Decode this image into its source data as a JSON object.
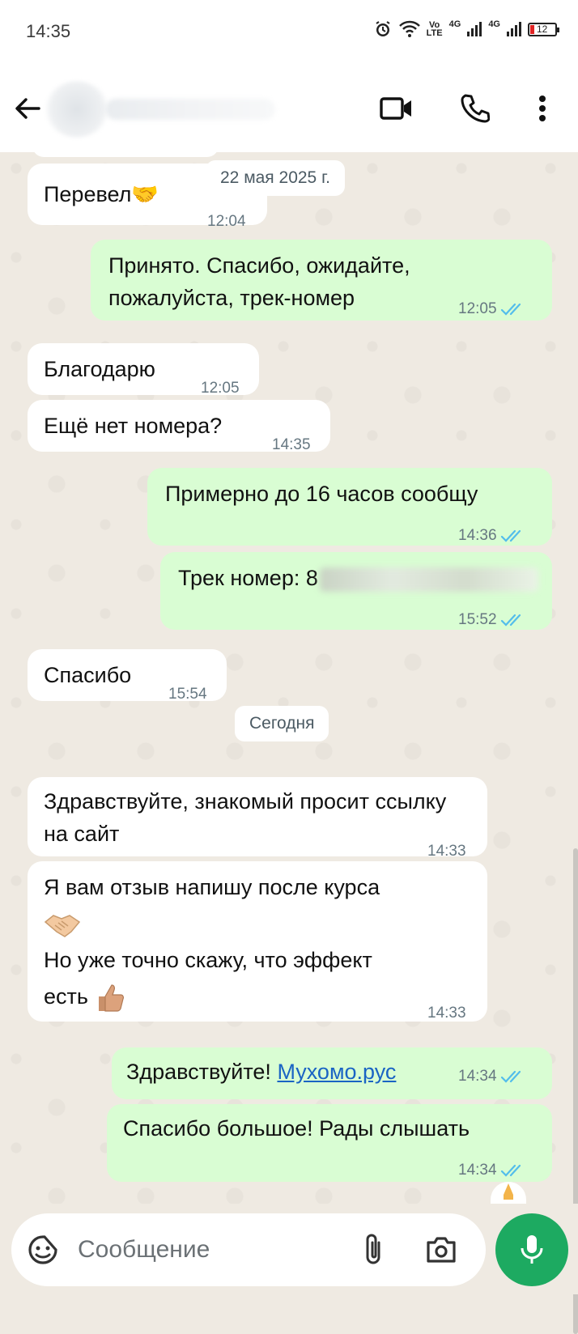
{
  "status_bar": {
    "time": "14:35",
    "volte_top": "Vo",
    "volte_bottom": "LTE",
    "net1": "4G",
    "net2": "4G",
    "battery": "12"
  },
  "header": {
    "back_icon": "arrow-left-icon",
    "video_icon": "video-camera-icon",
    "call_icon": "phone-icon",
    "menu_icon": "more-vertical-icon"
  },
  "chat": {
    "date_old": "22 мая 2025 г.",
    "date_today": "Сегодня",
    "messages": [
      {
        "text": "Перевел🤝",
        "time": "12:04",
        "dir": "in"
      },
      {
        "text": "Принято. Спасибо, ожидайте, пожалуйста, трек-номер",
        "time": "12:05",
        "dir": "out"
      },
      {
        "text": "Благодарю",
        "time": "12:05",
        "dir": "in"
      },
      {
        "text": "Ещё нет номера?",
        "time": "14:35",
        "dir": "in"
      },
      {
        "text": "Примерно до 16 часов сообщу",
        "time": "14:36",
        "dir": "out"
      },
      {
        "text": "Трек номер: 8",
        "time": "15:52",
        "dir": "out"
      },
      {
        "text": "Спасибо",
        "time": "15:54",
        "dir": "in"
      },
      {
        "text": "Здравствуйте, знакомый просит ссылку на сайт",
        "time": "14:33",
        "dir": "in"
      },
      {
        "text_line1": "Я вам отзыв напишу после курса",
        "text_line3": "Но уже точно скажу, что эффект",
        "text_line4": "есть",
        "time": "14:33",
        "dir": "in"
      },
      {
        "text": "Здравствуйте!",
        "link": "Мухомо.рус",
        "time": "14:34",
        "dir": "out"
      },
      {
        "text": "Спасибо большое! Рады слышать",
        "time": "14:34",
        "dir": "out"
      }
    ]
  },
  "input": {
    "placeholder": "Сообщение",
    "sticker_icon": "sticker-icon",
    "attach_icon": "paperclip-icon",
    "camera_icon": "camera-icon",
    "mic_icon": "microphone-icon"
  },
  "colors": {
    "incoming": "#ffffff",
    "outgoing": "#d9fdd3",
    "accent": "#1daa61",
    "read_ticks": "#53bdeb",
    "link": "#1a64c4"
  }
}
